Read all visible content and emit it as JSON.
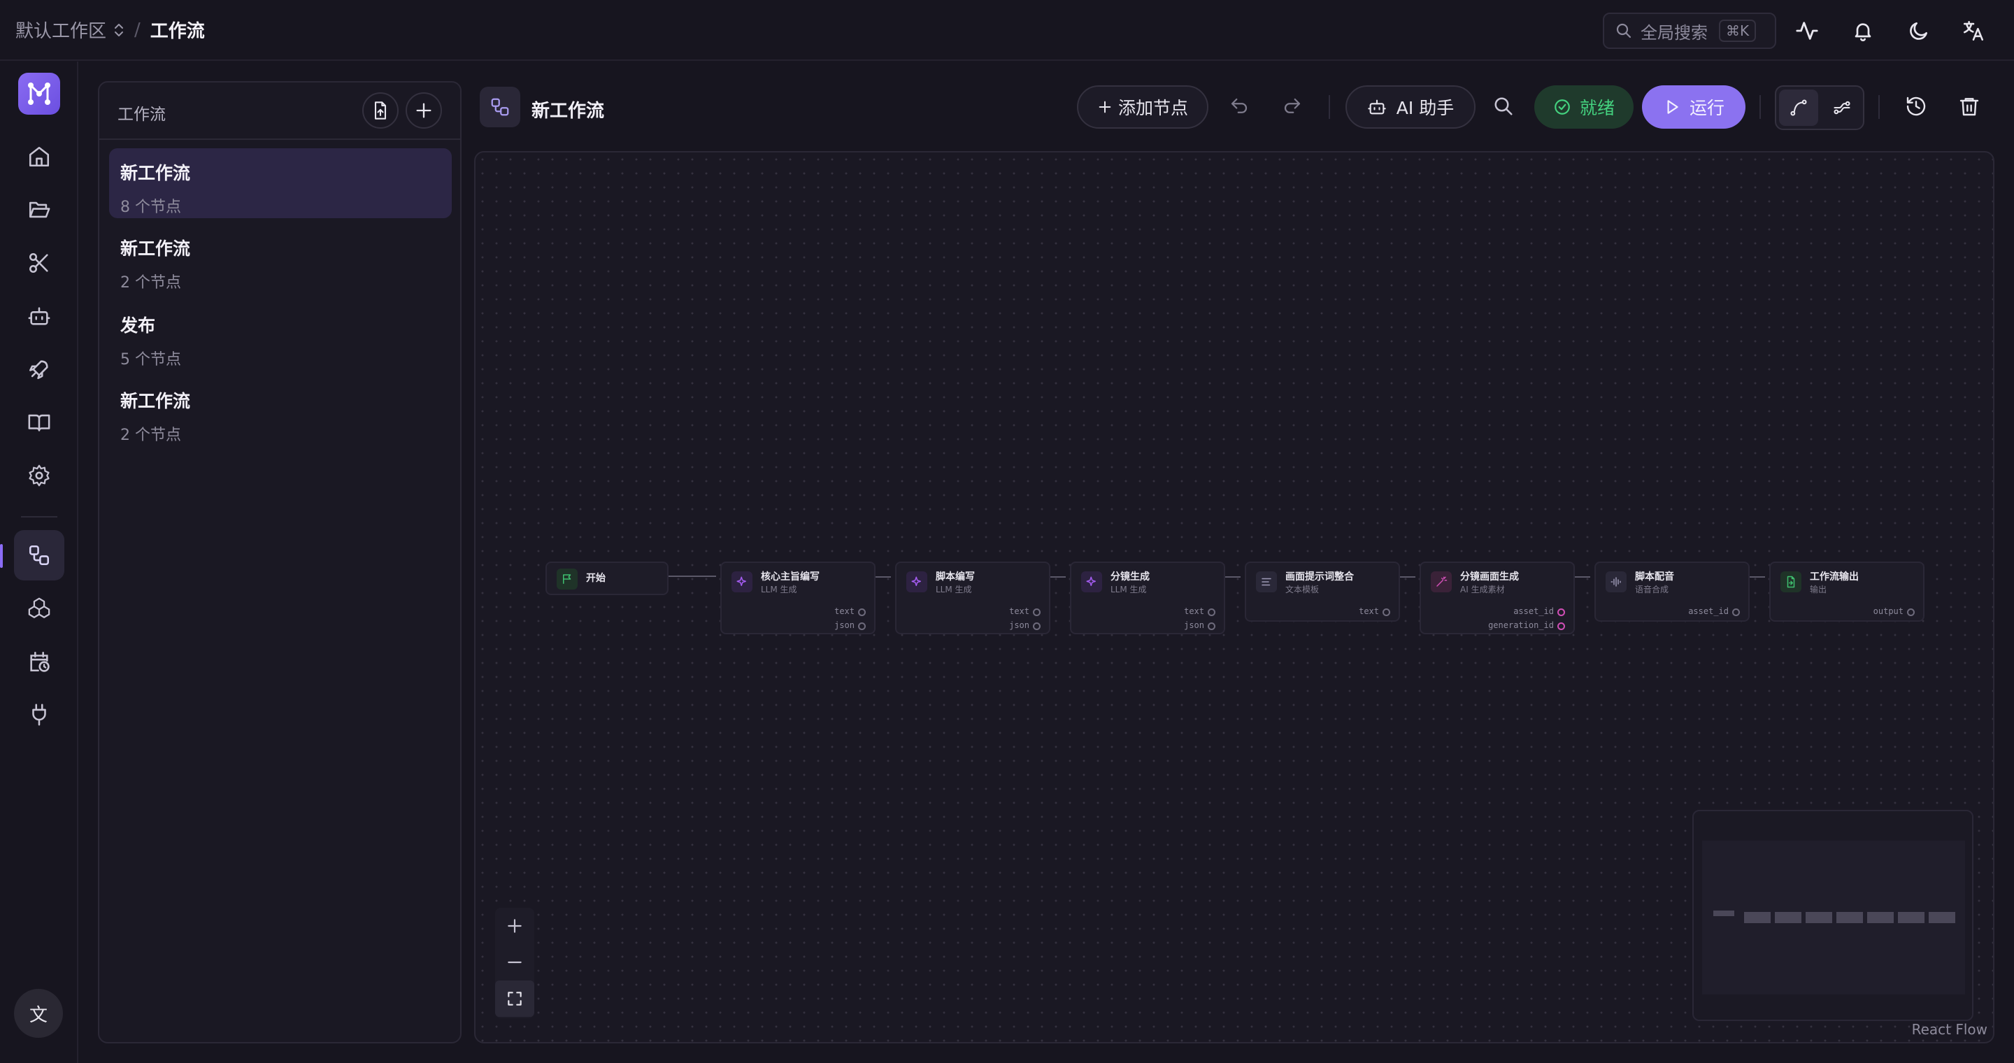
{
  "topbar": {
    "workspace": "默认工作区",
    "separator": "/",
    "current": "工作流",
    "search_placeholder": "全局搜索",
    "search_shortcut": "⌘K"
  },
  "rail": {
    "logo": "workflow-logo-icon",
    "items": [
      "home-icon",
      "folder-open-icon",
      "scissors-icon",
      "bot-icon",
      "rocket-icon",
      "book-open-icon",
      "settings-icon",
      "workflow-icon",
      "boxes-icon",
      "calendar-clock-icon",
      "plug-icon"
    ],
    "active_item": "workflow-icon",
    "language_label": "文"
  },
  "workflow_panel": {
    "title": "工作流",
    "items": [
      {
        "name": "新工作流",
        "count": "8 个节点"
      },
      {
        "name": "新工作流",
        "count": "2 个节点"
      },
      {
        "name": "发布",
        "count": "5 个节点"
      },
      {
        "name": "新工作流",
        "count": "2 个节点"
      }
    ]
  },
  "toolbar": {
    "flow_name": "新工作流",
    "add_node": "添加节点",
    "ai_assistant": "AI 助手",
    "status": "就绪",
    "run": "运行"
  },
  "canvas": {
    "nodes": [
      {
        "title": "开始",
        "subtitle": "",
        "ports": []
      },
      {
        "title": "核心主旨编写",
        "subtitle": "LLM 生成",
        "ports": [
          "text",
          "json"
        ]
      },
      {
        "title": "脚本编写",
        "subtitle": "LLM 生成",
        "ports": [
          "text",
          "json"
        ]
      },
      {
        "title": "分镜生成",
        "subtitle": "LLM 生成",
        "ports": [
          "text",
          "json"
        ]
      },
      {
        "title": "画面提示词整合",
        "subtitle": "文本模板",
        "ports": [
          "text"
        ]
      },
      {
        "title": "分镜画面生成",
        "subtitle": "AI 生成素材",
        "ports": [
          "asset_id",
          "generation_id"
        ]
      },
      {
        "title": "脚本配音",
        "subtitle": "语音合成",
        "ports": [
          "asset_id"
        ]
      },
      {
        "title": "工作流输出",
        "subtitle": "输出",
        "ports": [
          "output"
        ]
      }
    ],
    "attribution": "React Flow"
  },
  "colors": {
    "accent": "#8b72f0",
    "ready": "#44d27f",
    "llm_icon": "#a45cf0",
    "start_icon": "#3fbf6f",
    "image_port": "#d04fb6"
  }
}
